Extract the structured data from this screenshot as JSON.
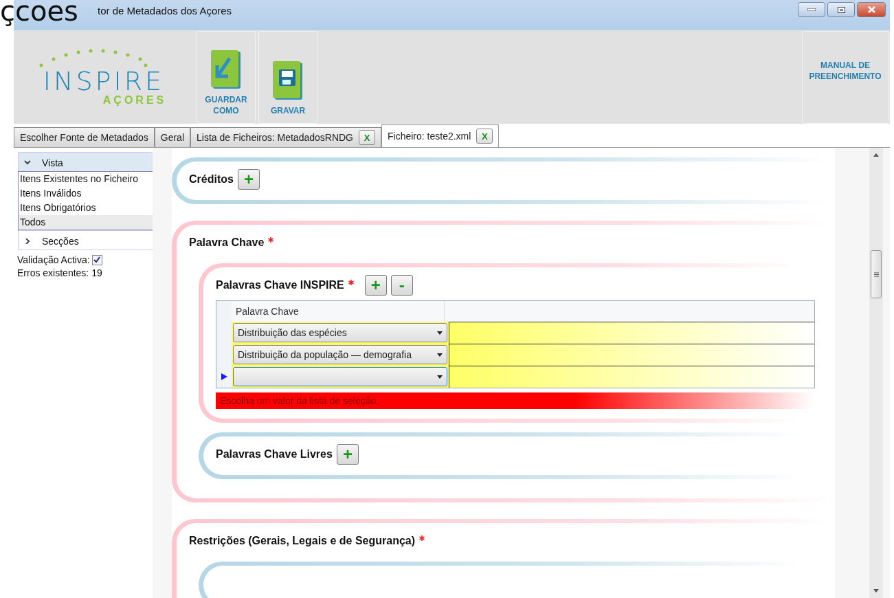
{
  "overlay_text": "çcoes",
  "window": {
    "title": "tor de Metadados dos Açores"
  },
  "toolbar": {
    "logo": {
      "main": "INSPIRE",
      "sub": "AÇORES"
    },
    "buttons": [
      {
        "kind": "save-as",
        "label": "GUARDAR COMO"
      },
      {
        "kind": "save",
        "label": "GRAVAR"
      }
    ],
    "help_button": "MANUAL DE PREENCHIMENTO"
  },
  "tabs": [
    {
      "label": "Escolher Fonte de Metadados",
      "closable": false,
      "selected": false
    },
    {
      "label": "Geral",
      "closable": false,
      "selected": false
    },
    {
      "label": "Lista de Ficheiros: MetadadosRNDG",
      "closable": true,
      "close": "X",
      "selected": false
    },
    {
      "label": "Ficheiro: teste2.xml",
      "closable": true,
      "close": "X",
      "selected": true
    }
  ],
  "sidebar": {
    "groups": [
      {
        "label": "Vista",
        "expanded": true,
        "items": [
          {
            "label": "Itens Existentes no Ficheiro",
            "selected": false
          },
          {
            "label": "Itens Inválidos",
            "selected": false
          },
          {
            "label": "Itens Obrigatórios",
            "selected": false
          },
          {
            "label": "Todos",
            "selected": true
          }
        ]
      },
      {
        "label": "Secções",
        "expanded": false
      }
    ],
    "validation": {
      "label": "Validação Activa:",
      "checked": true
    },
    "errors": "Erros existentes: 19"
  },
  "sections": [
    {
      "kind": "blue",
      "title": "Créditos",
      "required": false,
      "buttons": [
        "+"
      ]
    },
    {
      "kind": "pink",
      "title": "Palavra Chave",
      "required": true,
      "children": [
        {
          "kind": "pink",
          "title": "Palavras Chave INSPIRE",
          "required": true,
          "buttons": [
            "+",
            "-"
          ],
          "table": {
            "columns": [
              "Palavra Chave"
            ],
            "rows": [
              {
                "value": "Distribuição das espécies",
                "current": false
              },
              {
                "value": "Distribuição da população — demografia",
                "current": false
              },
              {
                "value": "",
                "current": true
              }
            ]
          },
          "error": "Escolha um valor da lista de seleção."
        },
        {
          "kind": "blue",
          "title": "Palavras Chave Livres",
          "required": false,
          "buttons": [
            "+"
          ]
        }
      ]
    },
    {
      "kind": "pink",
      "title": "Restrições (Gerais, Legais e de Segurança)",
      "required": true,
      "children": [
        {
          "kind": "blue"
        }
      ]
    }
  ]
}
